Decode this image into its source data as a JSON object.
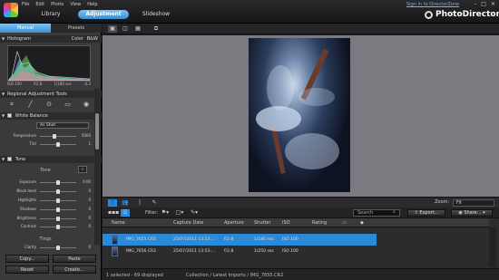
{
  "menu": [
    "File",
    "Edit",
    "Photo",
    "View",
    "Help"
  ],
  "modes": [
    {
      "label": "Library",
      "active": false
    },
    {
      "label": "Adjustment",
      "active": true
    },
    {
      "label": "Slideshow",
      "active": false
    }
  ],
  "header": {
    "signin": "Sign in to DirectorZone",
    "brand": "PhotoDirector"
  },
  "window_controls": [
    "–",
    "□",
    "✕"
  ],
  "panel": {
    "tabs": [
      "Manual",
      "Presets"
    ],
    "histogram": {
      "title": "Histogram",
      "mode_color": "Color",
      "mode_bw": "B&W",
      "info": [
        "ISO 100",
        "f/2.8",
        "1/180 sec",
        "-0.3"
      ]
    },
    "regional": {
      "title": "Regional Adjustment Tools"
    },
    "white_balance": {
      "title": "White Balance",
      "preset": "As Shot",
      "temperature_label": "Temperature",
      "temperature_value": "5000",
      "tint_label": "Tint",
      "tint_value": "1"
    },
    "tone": {
      "title": "Tone",
      "sub": "Tone",
      "rows": [
        {
          "label": "Exposure",
          "value": "0.00"
        },
        {
          "label": "Black level",
          "value": "0"
        },
        {
          "label": "Highlights",
          "value": "0"
        },
        {
          "label": "Shadows",
          "value": "0"
        },
        {
          "label": "Brightness",
          "value": "0"
        },
        {
          "label": "Contrast",
          "value": "0"
        }
      ],
      "tings": "Tings",
      "clarity_label": "Clarity",
      "clarity_value": "0"
    },
    "buttons": {
      "copy": "Copy...",
      "paste": "Paste",
      "reset": "Reset",
      "create": "Create..."
    }
  },
  "toolbar": {
    "zoom_label": "Zoom:",
    "zoom_value": "Fit",
    "filter_label": "Filter:",
    "search_placeholder": "Search",
    "export": "Export...",
    "share": "Share..."
  },
  "table": {
    "columns": [
      "Name",
      "Capture Date",
      "Aperture",
      "Shutter",
      "ISO",
      "Rating"
    ],
    "rows": [
      {
        "name": "IMG_7655.CR2",
        "date": "25/07/2011 13:53:…",
        "aperture": "f/2.8",
        "shutter": "1/180 sec",
        "iso": "ISO 100",
        "selected": true
      },
      {
        "name": "IMG_7656.CR2",
        "date": "25/07/2011 13:53:…",
        "aperture": "f/2.8",
        "shutter": "1/250 sec",
        "iso": "ISO 100",
        "selected": false
      }
    ]
  },
  "status": {
    "left": "1 selected - 69 displayed",
    "path": "Collection / Latest Imports / IMG_7655.CR2"
  }
}
